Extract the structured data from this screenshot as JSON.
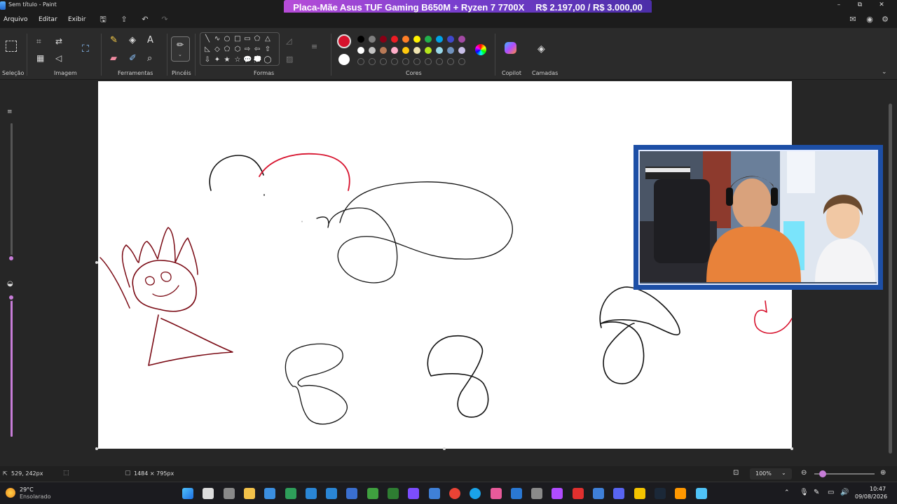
{
  "window": {
    "title": "Sem título - Paint",
    "controls": {
      "minimize": "–",
      "maximize": "⧉",
      "close": "✕"
    }
  },
  "banner": {
    "product": "Placa-Mãe Asus TUF Gaming B650M + Ryzen 7 7700X",
    "price": "R$ 2.197,00 / R$ 3.000,00"
  },
  "menu": [
    "Arquivo",
    "Editar",
    "Exibir"
  ],
  "ribbon": {
    "groups": {
      "selecao": "Seleção",
      "imagem": "Imagem",
      "ferramentas": "Ferramentas",
      "pinceis": "Pincéis",
      "formas": "Formas",
      "cores": "Cores",
      "copilot": "Copilot",
      "camadas": "Camadas"
    },
    "text_tool": "A",
    "shapes": [
      "╲",
      "∿",
      "○",
      "□",
      "▭",
      "⬠",
      "△",
      "◺",
      "◇",
      "⬠",
      "⬡",
      "⇨",
      "⇧",
      "⇩",
      "⇦",
      "✦",
      "★",
      "☆",
      "💬",
      "💭",
      "◯"
    ],
    "current_color": "#d7122d",
    "secondary_color": "#ffffff",
    "palette": [
      [
        "#000000",
        "#7f7f7f",
        "#880015",
        "#ed1c24",
        "#ff7f27",
        "#fff200",
        "#22b14c",
        "#00a2e8",
        "#3f48cc",
        "#a349a4"
      ],
      [
        "#ffffff",
        "#c3c3c3",
        "#b97a57",
        "#ffaec9",
        "#ffc90e",
        "#efe4b0",
        "#b5e61d",
        "#99d9ea",
        "#7092be",
        "#c8bfe7"
      ]
    ]
  },
  "status": {
    "cursor_position": "529, 242px",
    "canvas_size": "1484 × 795px",
    "zoom": "100%"
  },
  "weather": {
    "temp": "29°C",
    "condition": "Ensolarado"
  },
  "clock": {
    "time": "10:47",
    "date": "09/08/2026"
  },
  "taskbar_icons": [
    "start",
    "search",
    "task-view",
    "file-explorer",
    "store",
    "notepad",
    "vscode-insiders",
    "vscode",
    "azure-data",
    "minecraft",
    "xbox",
    "obsidian",
    "files",
    "chrome",
    "edge",
    "osu",
    "outlook",
    "settings",
    "copilot",
    "opera",
    "photos",
    "discord",
    "norton",
    "steam",
    "sublime",
    "paint"
  ],
  "colors": {
    "accent": "#c77dd8",
    "banner_start": "#b74cd8",
    "webcam_border": "#1d4fa6"
  }
}
